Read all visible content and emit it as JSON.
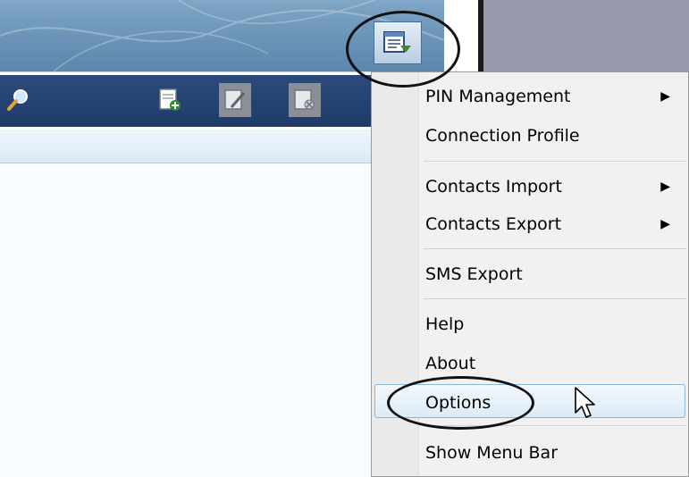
{
  "window": {
    "title_bar_icon": "menu-dropdown-icon"
  },
  "toolbar": {
    "icons": [
      "search-icon",
      "add-contact-icon",
      "edit-contact-icon",
      "delete-contact-icon"
    ]
  },
  "menu": {
    "items": [
      {
        "label": "PIN Management",
        "submenu": true
      },
      {
        "label": "Connection Profile",
        "submenu": false
      },
      {
        "label": "Contacts Import",
        "submenu": true
      },
      {
        "label": "Contacts Export",
        "submenu": true
      },
      {
        "label": "SMS Export",
        "submenu": false
      },
      {
        "label": "Help",
        "submenu": false
      },
      {
        "label": "About",
        "submenu": false
      },
      {
        "label": "Options",
        "submenu": false
      },
      {
        "label": "Show Menu Bar",
        "submenu": false
      }
    ],
    "hovered": "Options",
    "submenu_arrow": "▶"
  },
  "colors": {
    "header": "#6a93b7",
    "toolbar": "#1f3b69",
    "menu_bg": "#f1f1f1",
    "highlight": "#dcebf7"
  }
}
